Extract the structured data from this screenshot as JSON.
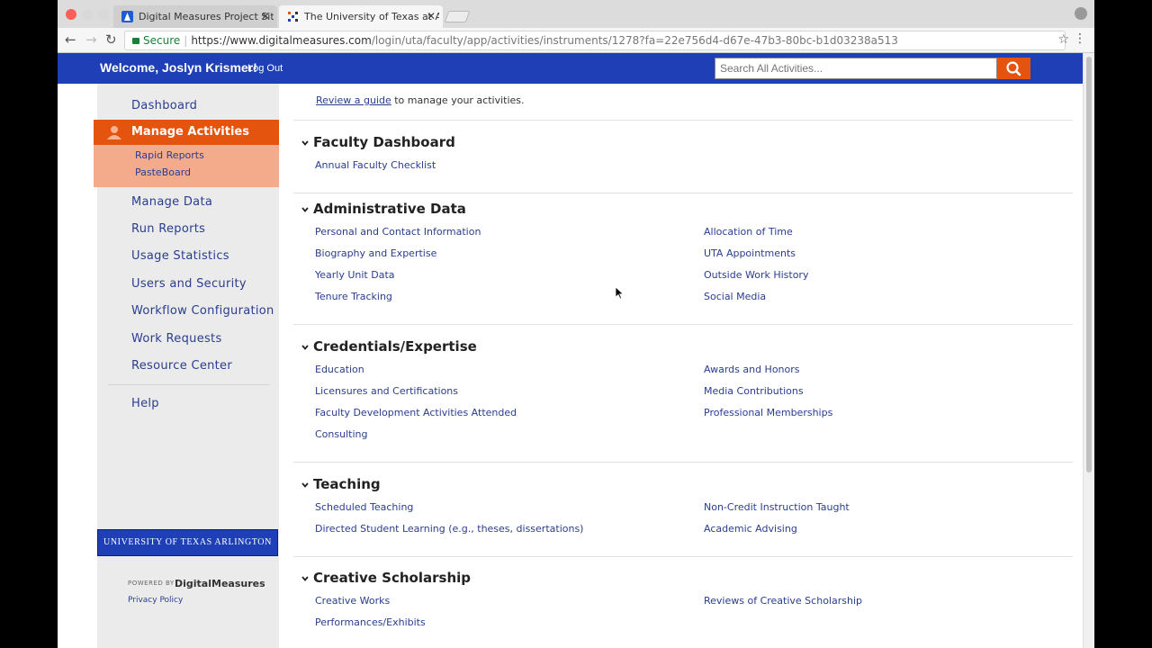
{
  "browser": {
    "tabs": [
      {
        "title": "Digital Measures Project Site -",
        "active": false
      },
      {
        "title": "The University of Texas at Arlin",
        "active": true
      }
    ],
    "tab_close": "✕",
    "url_secure_label": "Secure",
    "url_host": "https://www.digitalmeasures.com",
    "url_path": "/login/uta/faculty/app/activities/instruments/1278?fa=22e756d4-d67e-47b3-80bc-b1d03238a513",
    "icons": [
      "back-icon",
      "forward-icon",
      "reload-icon",
      "star-icon",
      "menu-icon",
      "profile-icon"
    ]
  },
  "header": {
    "welcome": "Welcome, Joslyn Krismer!",
    "logout": "Log Out",
    "search_placeholder": "Search All Activities...",
    "colors": {
      "bar": "#1e3fb5",
      "search_button": "#e5540f"
    }
  },
  "sidebar": {
    "dashboard": "Dashboard",
    "active": "Manage Activities",
    "sub_items": [
      "Rapid Reports",
      "PasteBoard"
    ],
    "items": [
      "Manage Data",
      "Run Reports",
      "Usage Statistics",
      "Users and Security",
      "Workflow Configuration",
      "Work Requests",
      "Resource Center"
    ],
    "help": "Help",
    "logo_text": "UNIVERSITY OF TEXAS ARLINGTON",
    "powered_by": "POWERED BY",
    "brand": "DigitalMeasures",
    "privacy": "Privacy Policy",
    "colors": {
      "active": "#e5540f",
      "active_sub": "#f3ab8c"
    }
  },
  "main": {
    "intro_link": "Review a guide",
    "intro_text": " to manage your activities.",
    "sections": [
      {
        "title": "Faculty Dashboard",
        "left": [
          "Annual Faculty Checklist"
        ],
        "right": []
      },
      {
        "title": "Administrative Data",
        "left": [
          "Personal and Contact Information",
          "Biography and Expertise",
          "Yearly Unit Data",
          "Tenure Tracking"
        ],
        "right": [
          "Allocation of Time",
          "UTA Appointments",
          "Outside Work History",
          "Social Media"
        ]
      },
      {
        "title": "Credentials/Expertise",
        "left": [
          "Education",
          "Licensures and Certifications",
          "Faculty Development Activities Attended",
          "Consulting"
        ],
        "right": [
          "Awards and Honors",
          "Media Contributions",
          "Professional Memberships"
        ]
      },
      {
        "title": "Teaching",
        "left": [
          "Scheduled Teaching",
          "Directed Student Learning (e.g., theses, dissertations)"
        ],
        "right": [
          "Non-Credit Instruction Taught",
          "Academic Advising"
        ]
      },
      {
        "title": "Creative Scholarship",
        "left": [
          "Creative Works",
          "Performances/Exhibits"
        ],
        "right": [
          "Reviews of Creative Scholarship"
        ]
      }
    ]
  }
}
